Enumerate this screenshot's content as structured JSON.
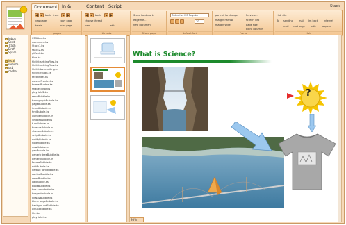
{
  "menubar": {
    "tabs": [
      "Document",
      "In & Out",
      "Content",
      "Script"
    ],
    "active_tab": "Document",
    "back": "Stack"
  },
  "ribbon": {
    "groups": [
      {
        "title": "pages",
        "labels": {
          "back": "back",
          "front": "front",
          "new_page": "new page",
          "copy_page": "copy page",
          "delete": "delete",
          "print_page": "print page"
        }
      },
      {
        "title": "threads",
        "labels": {
          "back": "back",
          "choose_thread": "choose thread",
          "new": "new",
          "edit": "edit"
        }
      },
      {
        "title": "Share page",
        "labels": {
          "share": "Share bookmark",
          "edge": "edge file...",
          "new_doc": "new document"
        }
      },
      {
        "title": "default font",
        "labels": {
          "font_name": "Trebuchet MS Regular",
          "size": "10"
        }
      },
      {
        "title": "Frame",
        "labels": {
          "a": "portrait landscape",
          "b": "margin narrow",
          "c": "margin wide",
          "d": "Preview...",
          "e": "screen info",
          "f": "page size",
          "g": "extra columns"
        }
      },
      {
        "title": "Hub",
        "labels": {
          "user": "Hub site",
          "a": "To",
          "b": "sending",
          "c": "mail",
          "d": "Im back",
          "e": "internet",
          "f": "mail",
          "g": "root page",
          "h": "edit",
          "i": "append"
        }
      }
    ]
  },
  "tree": {
    "items": [
      "Inbox",
      "Sent",
      "Trash",
      "Draft",
      "Spam",
      "local",
      "remote",
      "usb",
      "cache"
    ],
    "selected": "local"
  },
  "files": [
    "h3Sktml.ks",
    "document.ks",
    "Stack1.ks",
    "stack2.ks",
    "giffeet.ks",
    "files.ks",
    "filelist settingFiles.ks",
    "filelist settingFiles.ks",
    "filelist basesetting.ks",
    "filelist-rough.ks",
    "textFinder.ks",
    "extendFronter.ks",
    "formatBubble.ks",
    "shapeEditor.ks",
    "playfield2.ks",
    "sendBubble.ks",
    "transgraphBubble.ks",
    "pageBubble.ks",
    "insertBubble.ks",
    "findBubble.ks",
    "wanderBubble.ks",
    "visibleBubble.ks",
    "turnBubble.ks",
    "threadsBubble.ks",
    "shadowBubble.ks",
    "scriptBubble.ks",
    "notifyBubble.ks",
    "noteBubble.ks",
    "newBubble.ks",
    "geoBubble.ks",
    "generic treeBubble.ks",
    "genericBubble.ks",
    "FrameBubble.ks",
    "editBubble.ks",
    "default fontBubble.ks",
    "controlBubble.ks",
    "colorBubble.ks",
    "callBubble.ks",
    "bookBubble.ks",
    "box contributor.ks",
    "boxpartbubble.ks",
    "dirNavBubble.ks",
    "blank pageBubble.ks",
    "backgroundBubble.ks",
    "adjustBubble.ks",
    "file.ks",
    "playfield.ks"
  ],
  "page": {
    "title": "What is Science?",
    "question_mark": "?",
    "zoom": "98%"
  },
  "colors": {
    "title_green": "#1c8a2c",
    "frame_orange": "#f6d9b8",
    "sun_yellow": "#f2c000",
    "arrow_blue": "#7ab3e6"
  }
}
